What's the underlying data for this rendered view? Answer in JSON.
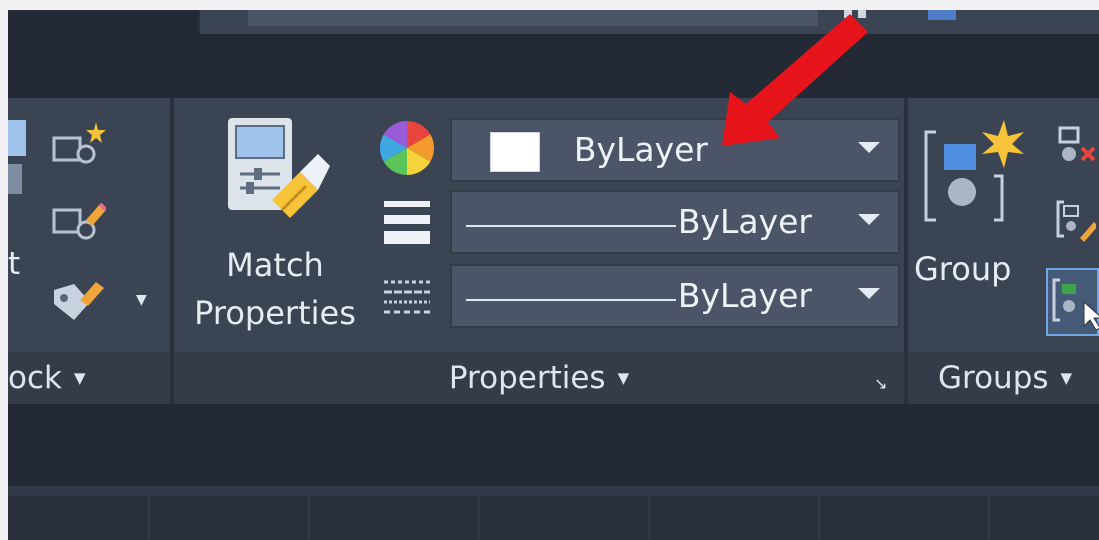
{
  "block_panel": {
    "insert_label_fragment": "t",
    "footer_label": "ock",
    "footer_caret": "▼"
  },
  "properties_panel": {
    "match_properties": {
      "line1": "Match",
      "line2": "Properties"
    },
    "combos": [
      {
        "id": "color",
        "value": "ByLayer",
        "icon": "color-wheel-icon"
      },
      {
        "id": "lineweight",
        "value": "ByLayer",
        "icon": "lineweight-icon"
      },
      {
        "id": "linetype",
        "value": "ByLayer",
        "icon": "linetype-icon"
      }
    ],
    "footer_label": "Properties",
    "footer_caret": "▼",
    "dialog_launcher": "↘"
  },
  "groups_panel": {
    "group_label": "Group",
    "footer_label": "Groups",
    "footer_caret": "▼"
  },
  "colors": {
    "ribbon_bg": "#3b4453",
    "app_bg": "#232a35",
    "combo_bg": "#4b5567",
    "arrow": "#e8141b"
  }
}
